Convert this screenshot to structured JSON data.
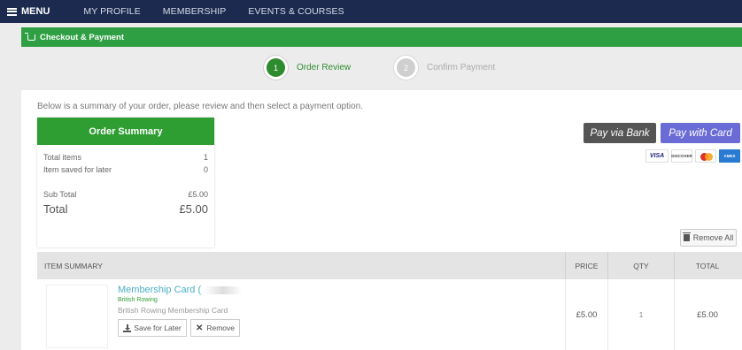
{
  "nav": {
    "menu_label": "MENU",
    "items": [
      "MY PROFILE",
      "MEMBERSHIP",
      "EVENTS & COURSES"
    ]
  },
  "panel": {
    "title": "Checkout & Payment"
  },
  "steps": [
    {
      "number": "1",
      "label": "Order Review",
      "active": true
    },
    {
      "number": "2",
      "label": "Confirm Payment",
      "active": false
    }
  ],
  "intro_text": "Below is a summary of your order, please review and then select a payment option.",
  "order_summary": {
    "title": "Order Summary",
    "total_items_label": "Total items",
    "total_items_value": "1",
    "saved_label": "Item saved for later",
    "saved_value": "0",
    "subtotal_label": "Sub Total",
    "subtotal_value": "£5.00",
    "total_label": "Total",
    "total_value": "£5.00"
  },
  "payment": {
    "bank_label": "Pay via Bank",
    "card_label": "Pay with Card",
    "cards": {
      "visa": "VISA",
      "discover": "DISCOVER",
      "amex": "AMEX"
    }
  },
  "remove_all_label": "Remove All",
  "table": {
    "headers": {
      "item": "ITEM SUMMARY",
      "price": "PRICE",
      "qty": "QTY",
      "total": "TOTAL"
    },
    "rows": [
      {
        "title": "Membership Card (",
        "org": "British Rowing",
        "description": "British Rowing Membership Card",
        "save_label": "Save for Later",
        "remove_label": "Remove",
        "price": "£5.00",
        "qty": "1",
        "total": "£5.00"
      }
    ]
  },
  "colors": {
    "nav_bg": "#1b2a4e",
    "brand_green": "#2ea043",
    "bank_button": "#555555",
    "card_button": "#6b6bd6",
    "link_teal": "#4ab0c4"
  }
}
